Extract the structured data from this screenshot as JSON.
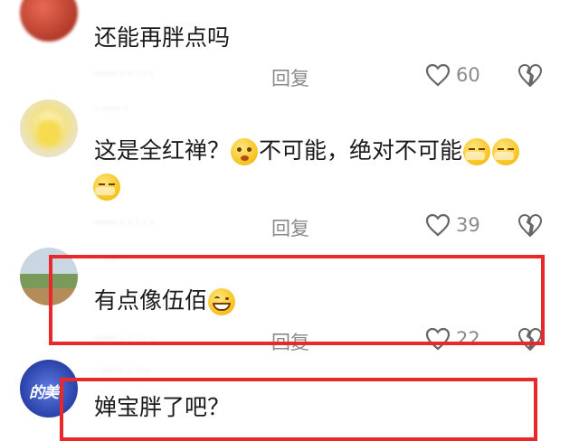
{
  "comments": [
    {
      "text": "还能再胖点吗",
      "reply_label": "回复",
      "likes": "60"
    },
    {
      "text": "这是全红禅？",
      "text_mid": "不可能，绝对不可能",
      "reply_label": "回复",
      "likes": "39"
    },
    {
      "text": "有点像伍佰",
      "reply_label": "回复",
      "likes": "22"
    },
    {
      "text": "婵宝胖了吧？"
    }
  ],
  "avatar_logo": "的美",
  "colors": {
    "highlight": "#e8282b",
    "meta": "#8a8a8a"
  },
  "icons": [
    "heart-icon",
    "broken-heart-icon"
  ]
}
